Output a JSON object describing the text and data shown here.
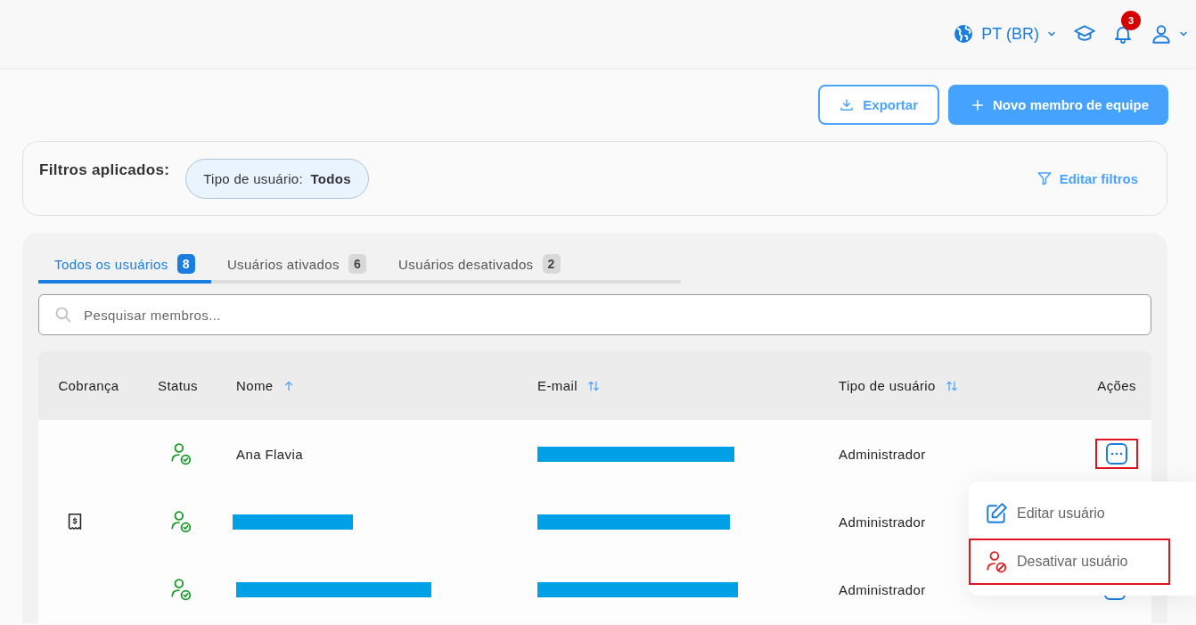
{
  "header": {
    "language": "PT (BR)",
    "notifications": "3"
  },
  "actions": {
    "export": "Exportar",
    "new_member": "Novo membro de equipe"
  },
  "filters": {
    "title": "Filtros aplicados:",
    "chips": [
      {
        "label": "Tipo de usuário:",
        "value": "Todos"
      }
    ],
    "edit": "Editar filtros"
  },
  "tabs": [
    {
      "label": "Todos os usuários",
      "count": "8",
      "selected": true
    },
    {
      "label": "Usuários ativados",
      "count": "6",
      "selected": false
    },
    {
      "label": "Usuários desativados",
      "count": "2",
      "selected": false
    }
  ],
  "search": {
    "placeholder": "Pesquisar membros..."
  },
  "table": {
    "columns": [
      {
        "label": "Cobrança",
        "kind": "plain"
      },
      {
        "label": "Status",
        "kind": "plain"
      },
      {
        "label": "Nome",
        "kind": "ascending"
      },
      {
        "label": "E-mail",
        "kind": "sortable"
      },
      {
        "label": "Tipo de usuário",
        "kind": "sortable"
      },
      {
        "label": "Ações",
        "kind": "plain"
      }
    ],
    "rows": [
      {
        "billing": false,
        "active": true,
        "name": "Ana Flavia",
        "name_redacted": false,
        "type": "Administrador",
        "highlighted": true
      },
      {
        "billing": true,
        "active": true,
        "name_redacted": true,
        "type": "Administrador",
        "highlighted": false
      },
      {
        "billing": false,
        "active": true,
        "name_redacted": true,
        "type": "Administrador",
        "highlighted": false
      }
    ]
  },
  "menu": {
    "items": [
      {
        "kind": "edit",
        "label": "Editar usuário",
        "highlighted": false
      },
      {
        "kind": "deactivate",
        "label": "Desativar usuário",
        "highlighted": true
      }
    ]
  }
}
